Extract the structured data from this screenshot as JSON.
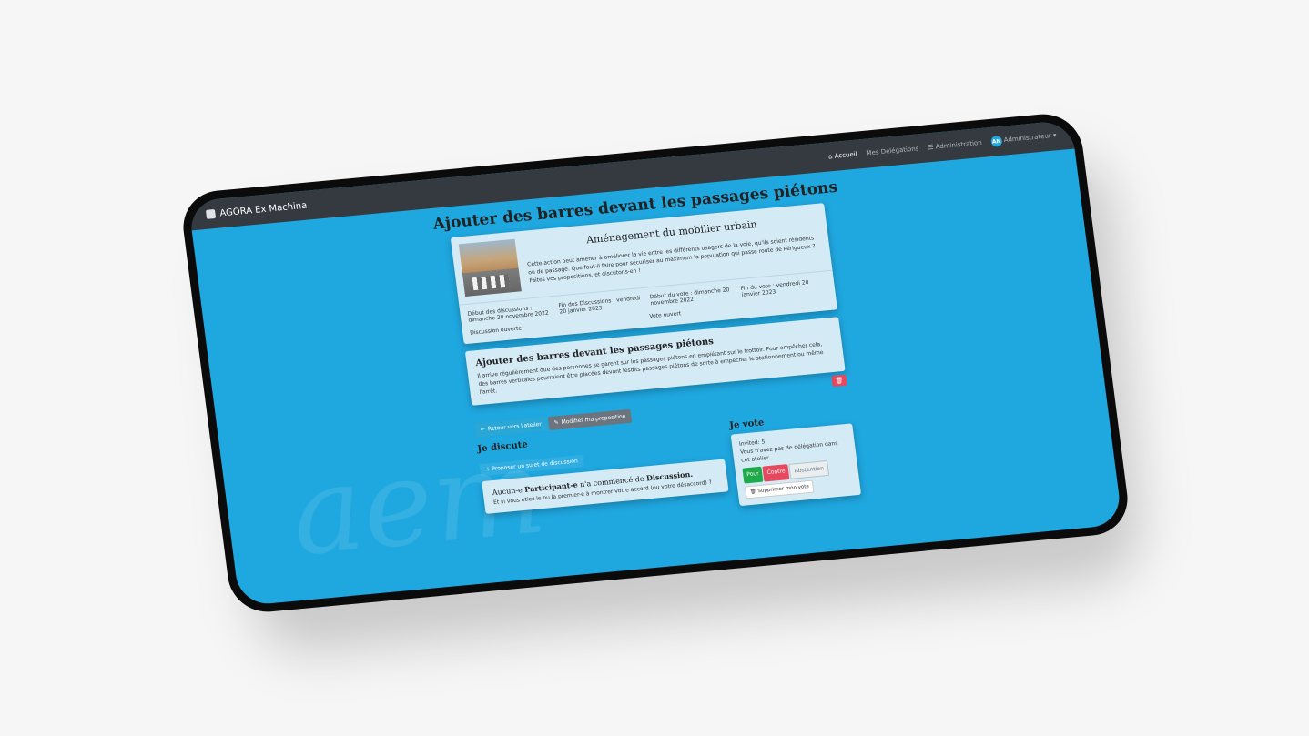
{
  "nav": {
    "brand": "AGORA Ex Machina",
    "home": "Accueil",
    "delegations": "Mes Délégations",
    "admin": "Administration",
    "avatar_initials": "AN",
    "user": "Administrateur"
  },
  "page": {
    "title": "Ajouter des barres devant les passages piétons"
  },
  "workshop": {
    "title": "Aménagement du mobilier urbain",
    "description": "Cette action peut amener à améliorer la vie entre les différents usagers de la voie, qu'ils soient résidents ou de passage. Que faut-il faire pour sécuriser au maximum la population qui passe route de Périgueux ? Faites vos propositions, et discutons-en !",
    "dates": [
      "Début des discussions : dimanche 20 novembre 2022",
      "Fin des Discussions : vendredi 20 janvier 2023",
      "Début du vote : dimanche 20 novembre 2022",
      "Fin du vote : vendredi 20 janvier 2023"
    ],
    "discussion_status": "Discussion ouverte",
    "vote_status": "Vote ouvert"
  },
  "proposal": {
    "title": "Ajouter des barres devant les passages piétons",
    "text": "Il arrive régulièrement que des personnes se garent sur les passages piétons en empiétant sur le trottoir. Pour empêcher cela, des barres verticales pourraient être placées devant lesdits passages piétons de sorte à empêcher le stationnement ou même l'arrêt.",
    "delete_icon": "trash-icon"
  },
  "actions": {
    "back": "Retour vers l'atelier",
    "edit": "Modifier ma proposition"
  },
  "discuss": {
    "title": "Je discute",
    "new_topic": "Proposer un sujet de discussion",
    "empty_title_prefix": "Aucun-e ",
    "empty_title_bold1": "Participant-e",
    "empty_title_mid": " n'a commencé de ",
    "empty_title_bold2": "Discussion.",
    "empty_text": "Et si vous étiez le ou la premier-e à montrer votre accord (ou votre désaccord) ?"
  },
  "vote": {
    "title": "Je vote",
    "invited": "Invited: 5",
    "no_delegation": "Vous n'avez pas de délégation dans cet atelier",
    "pour": "Pour",
    "contre": "Contre",
    "abstention": "Abstention",
    "delete": "Supprimer mon vote"
  }
}
